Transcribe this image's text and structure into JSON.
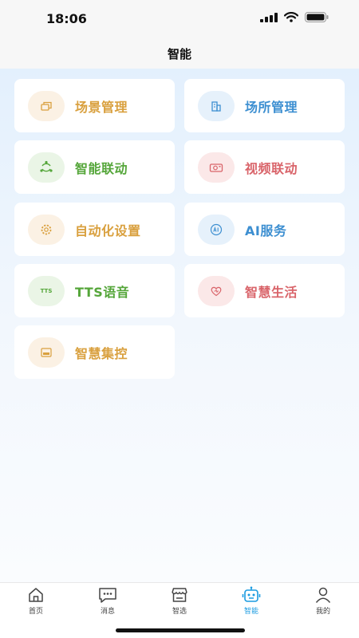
{
  "status_bar": {
    "time": "18:06",
    "icons": [
      "signal-icon",
      "wifi-icon",
      "battery-icon"
    ]
  },
  "header": {
    "title": "智能"
  },
  "cards": [
    {
      "label": "场景管理",
      "icon": "scene-icon",
      "color": "#d9a03e",
      "icon_bg": "#fbf1e4"
    },
    {
      "label": "场所管理",
      "icon": "building-icon",
      "color": "#3d8fd1",
      "icon_bg": "#e6f1fb"
    },
    {
      "label": "智能联动",
      "icon": "linkage-icon",
      "color": "#55a63a",
      "icon_bg": "#eaf5e6"
    },
    {
      "label": "视频联动",
      "icon": "camera-icon",
      "color": "#d9646a",
      "icon_bg": "#fbe8e8"
    },
    {
      "label": "自动化设置",
      "icon": "gear-icon",
      "color": "#d9a03e",
      "icon_bg": "#fbf1e4"
    },
    {
      "label": "AI服务",
      "icon": "ai-icon",
      "color": "#3d8fd1",
      "icon_bg": "#e6f1fb"
    },
    {
      "label": "TTS语音",
      "icon": "tts-icon",
      "icon_text": "TTS",
      "color": "#55a63a",
      "icon_bg": "#eaf5e6"
    },
    {
      "label": "智慧生活",
      "icon": "heart-icon",
      "color": "#d9646a",
      "icon_bg": "#fbe8e8"
    },
    {
      "label": "智慧集控",
      "icon": "panel-icon",
      "color": "#d9a03e",
      "icon_bg": "#fbf1e4"
    }
  ],
  "tab_bar": {
    "active_color": "#1a9be0",
    "tabs": [
      {
        "label": "首页",
        "icon": "home-icon",
        "active": false
      },
      {
        "label": "消息",
        "icon": "message-icon",
        "active": false
      },
      {
        "label": "智选",
        "icon": "store-icon",
        "active": false
      },
      {
        "label": "智能",
        "icon": "robot-icon",
        "active": true
      },
      {
        "label": "我的",
        "icon": "user-icon",
        "active": false
      }
    ]
  }
}
